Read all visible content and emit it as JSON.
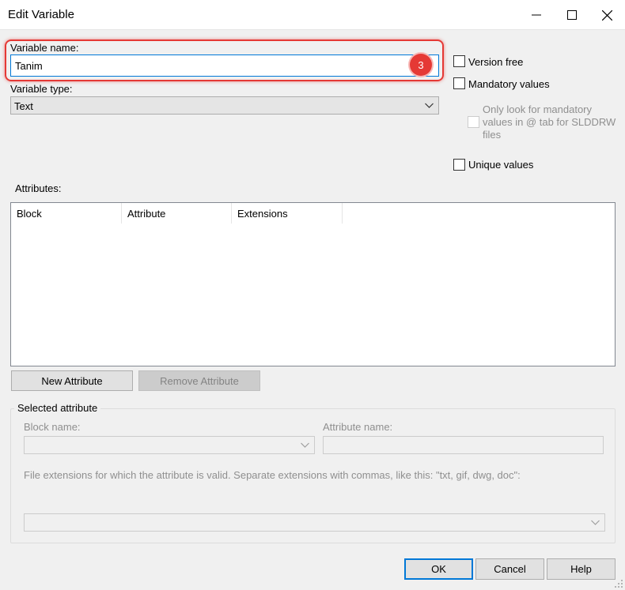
{
  "window": {
    "title": "Edit Variable",
    "controls": [
      "minimize-icon",
      "maximize-icon",
      "close-icon"
    ]
  },
  "variable_name": {
    "label": "Variable name:",
    "value": "Tanim"
  },
  "annotation": {
    "step_number": "3",
    "color": "#e53935"
  },
  "variable_type": {
    "label": "Variable type:",
    "selected": "Text"
  },
  "options": {
    "version_free": {
      "label": "Version free",
      "checked": false
    },
    "mandatory_values": {
      "label": "Mandatory values",
      "checked": false
    },
    "only_mandatory": {
      "label": "Only look for mandatory values in @ tab for SLDDRW files",
      "checked": false,
      "enabled": false
    },
    "unique_values": {
      "label": "Unique values",
      "checked": false
    }
  },
  "attributes": {
    "label": "Attributes:",
    "columns": [
      "Block",
      "Attribute",
      "Extensions"
    ],
    "rows": []
  },
  "buttons": {
    "new_attribute": "New Attribute",
    "remove_attribute": "Remove Attribute",
    "ok": "OK",
    "cancel": "Cancel",
    "help": "Help"
  },
  "selected_attribute": {
    "title": "Selected attribute",
    "block_name_label": "Block name:",
    "block_name_value": "",
    "attribute_name_label": "Attribute name:",
    "attribute_name_value": "",
    "extensions_label": "File extensions for which the attribute is valid. Separate extensions with commas, like this: \"txt, gif, dwg, doc\":",
    "extensions_value": ""
  },
  "colors": {
    "accent": "#0078d7",
    "dialog_bg": "#f0f0f0"
  }
}
